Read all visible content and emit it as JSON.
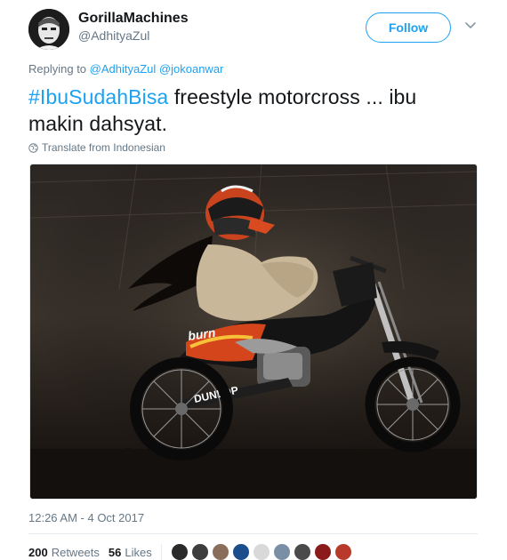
{
  "user": {
    "display_name": "GorillaMachines",
    "handle": "@AdhityaZul"
  },
  "follow_label": "Follow",
  "reply": {
    "prefix": "Replying to",
    "mentions": [
      "@AdhityaZul",
      "@jokoanwar"
    ]
  },
  "tweet": {
    "hashtag": "#IbuSudahBisa",
    "text": " freestyle motorcross ... ibu makin dahsyat."
  },
  "translate_label": "Translate from Indonesian",
  "media": {
    "bike_brand": "burn",
    "tire_brand": "DUNLOP"
  },
  "timestamp": "12:26 AM - 4 Oct 2017",
  "stats": {
    "retweets_count": "200",
    "retweets_label": "Retweets",
    "likes_count": "56",
    "likes_label": "Likes"
  },
  "likers": [
    {
      "color": "#2a2a2a"
    },
    {
      "color": "#3d3d3d"
    },
    {
      "color": "#8a6d5a"
    },
    {
      "color": "#1b4c8c"
    },
    {
      "color": "#d9d9d9"
    },
    {
      "color": "#7a8fa6"
    },
    {
      "color": "#4a4a4a"
    },
    {
      "color": "#8b1a1a"
    },
    {
      "color": "#b83a2a"
    }
  ],
  "colors": {
    "accent": "#1da1f2",
    "text_primary": "#14171a",
    "text_secondary": "#657786"
  }
}
